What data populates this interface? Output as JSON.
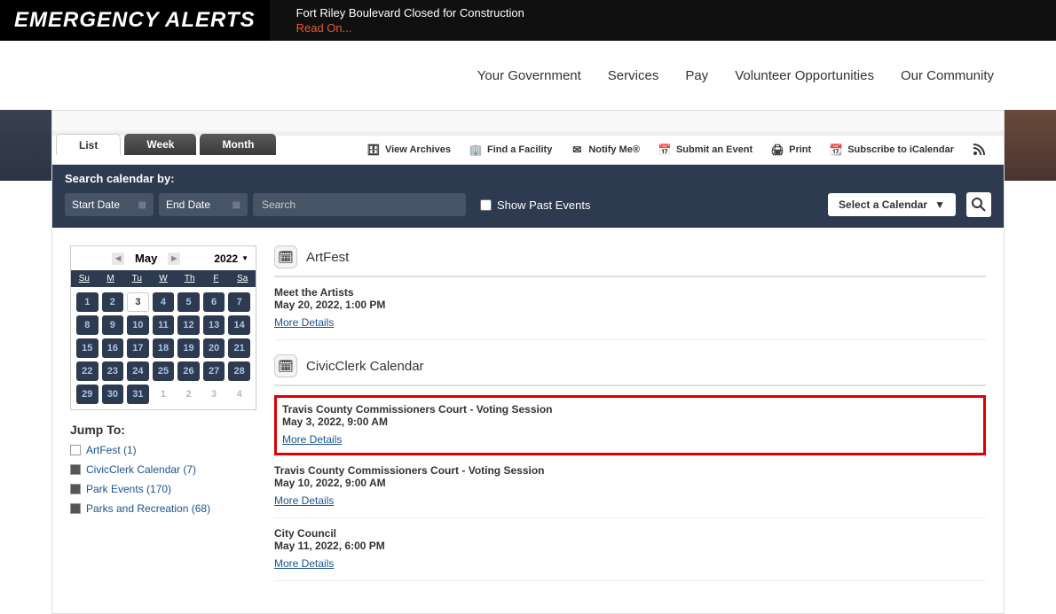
{
  "alert": {
    "title": "EMERGENCY ALERTS",
    "message": "Fort Riley Boulevard Closed for Construction",
    "read_more": "Read On..."
  },
  "nav": {
    "items": [
      "Your Government",
      "Services",
      "Pay",
      "Volunteer Opportunities",
      "Our Community"
    ]
  },
  "tabs": {
    "list": "List",
    "week": "Week",
    "month": "Month"
  },
  "toolbar": {
    "view_archives": "View Archives",
    "find_facility": "Find a Facility",
    "notify_me": "Notify Me®",
    "submit_event": "Submit an Event",
    "print": "Print",
    "subscribe": "Subscribe to iCalendar"
  },
  "search": {
    "label": "Search calendar by:",
    "start_placeholder": "Start Date",
    "end_placeholder": "End Date",
    "search_placeholder": "Search",
    "show_past": "Show Past Events",
    "select_calendar": "Select a Calendar"
  },
  "mini_calendar": {
    "month": "May",
    "year": "2022",
    "day_names": [
      "Su",
      "M",
      "Tu",
      "W",
      "Th",
      "F",
      "Sa"
    ],
    "days": [
      {
        "n": "1",
        "t": "in"
      },
      {
        "n": "2",
        "t": "in"
      },
      {
        "n": "3",
        "t": "today"
      },
      {
        "n": "4",
        "t": "in"
      },
      {
        "n": "5",
        "t": "in"
      },
      {
        "n": "6",
        "t": "in"
      },
      {
        "n": "7",
        "t": "in"
      },
      {
        "n": "8",
        "t": "in"
      },
      {
        "n": "9",
        "t": "in"
      },
      {
        "n": "10",
        "t": "in"
      },
      {
        "n": "11",
        "t": "in"
      },
      {
        "n": "12",
        "t": "in"
      },
      {
        "n": "13",
        "t": "in"
      },
      {
        "n": "14",
        "t": "in"
      },
      {
        "n": "15",
        "t": "in"
      },
      {
        "n": "16",
        "t": "in"
      },
      {
        "n": "17",
        "t": "in"
      },
      {
        "n": "18",
        "t": "in"
      },
      {
        "n": "19",
        "t": "in"
      },
      {
        "n": "20",
        "t": "in"
      },
      {
        "n": "21",
        "t": "in"
      },
      {
        "n": "22",
        "t": "in"
      },
      {
        "n": "23",
        "t": "in"
      },
      {
        "n": "24",
        "t": "in"
      },
      {
        "n": "25",
        "t": "in"
      },
      {
        "n": "26",
        "t": "in"
      },
      {
        "n": "27",
        "t": "in"
      },
      {
        "n": "28",
        "t": "in"
      },
      {
        "n": "29",
        "t": "in"
      },
      {
        "n": "30",
        "t": "in"
      },
      {
        "n": "31",
        "t": "in"
      },
      {
        "n": "1",
        "t": "out"
      },
      {
        "n": "2",
        "t": "out"
      },
      {
        "n": "3",
        "t": "out"
      },
      {
        "n": "4",
        "t": "out"
      }
    ]
  },
  "jump_to": {
    "title": "Jump To:",
    "items": [
      {
        "label": "ArtFest (1)",
        "filled": false
      },
      {
        "label": "CivicClerk Calendar (7)",
        "filled": true
      },
      {
        "label": "Park Events (170)",
        "filled": true
      },
      {
        "label": "Parks and Recreation (68)",
        "filled": true
      }
    ]
  },
  "event_sections": [
    {
      "title": "ArtFest",
      "events": [
        {
          "title": "Meet the Artists",
          "date": "May 20, 2022, 1:00 PM",
          "more": "More Details",
          "highlight": false
        }
      ]
    },
    {
      "title": "CivicClerk Calendar",
      "events": [
        {
          "title": "Travis County Commissioners Court - Voting Session",
          "date": "May 3, 2022, 9:00 AM",
          "more": "More Details",
          "highlight": true
        },
        {
          "title": "Travis County Commissioners Court - Voting Session",
          "date": "May 10, 2022, 9:00 AM",
          "more": "More Details",
          "highlight": false
        },
        {
          "title": "City Council",
          "date": "May 11, 2022, 6:00 PM",
          "more": "More Details",
          "highlight": false
        }
      ]
    }
  ]
}
